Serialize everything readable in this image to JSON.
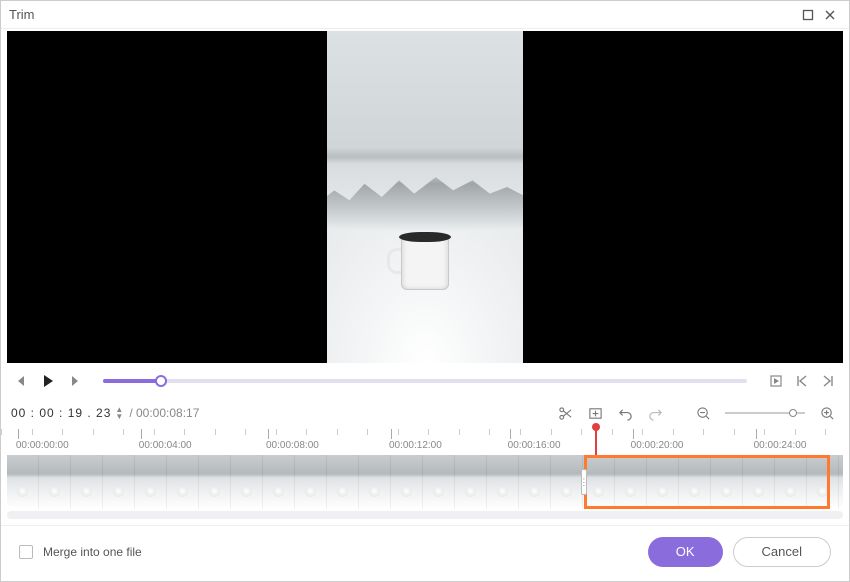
{
  "window": {
    "title": "Trim"
  },
  "playback": {
    "current_time": "00 : 00 : 19 . 23",
    "duration": "/ 00:00:08:17",
    "progress_percent": 9
  },
  "timeline": {
    "ticks": [
      {
        "label": "00:00:00:00",
        "pos": 2
      },
      {
        "label": "00:00:04:00",
        "pos": 16.5
      },
      {
        "label": "00:00:08:00",
        "pos": 31.5
      },
      {
        "label": "00:00:12:00",
        "pos": 46
      },
      {
        "label": "00:00:16:00",
        "pos": 60
      },
      {
        "label": "00:00:20:00",
        "pos": 74.5
      },
      {
        "label": "00:00:24:00",
        "pos": 89
      }
    ],
    "thumb_count": 27,
    "playhead_percent": 70,
    "selection_start_percent": 69,
    "selection_end_percent": 98.5
  },
  "footer": {
    "merge_label": "Merge into one file",
    "ok_label": "OK",
    "cancel_label": "Cancel"
  },
  "colors": {
    "accent": "#8b6cdd",
    "selection": "#ff7a2e",
    "playhead": "#e04040"
  }
}
